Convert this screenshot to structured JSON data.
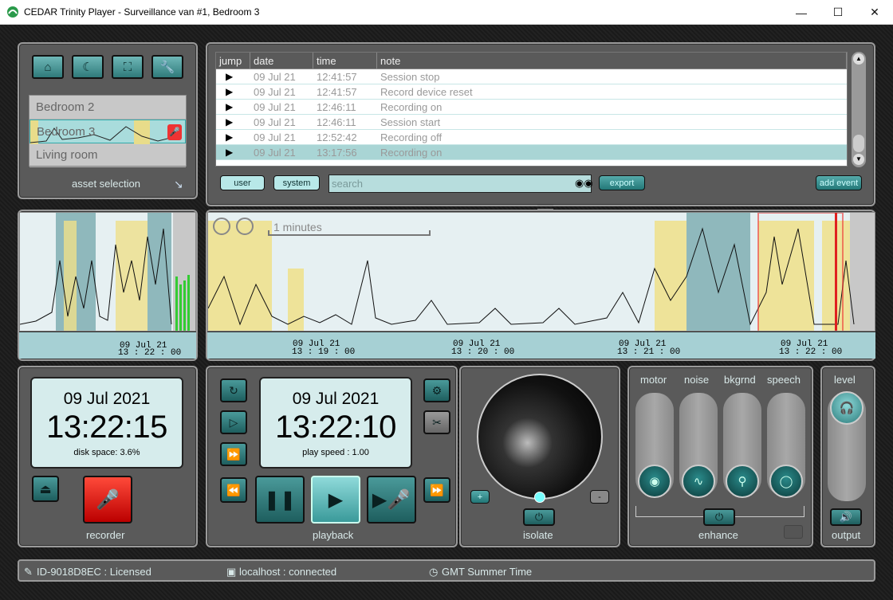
{
  "window": {
    "title": "CEDAR Trinity Player - Surveillance van #1, Bedroom 3"
  },
  "toolbar": {
    "icons": [
      "home-icon",
      "night-mode-icon",
      "fullscreen-icon",
      "settings-wrench-icon"
    ]
  },
  "assets": {
    "items": [
      "Bedroom 2",
      "Bedroom 3",
      "Living room"
    ],
    "selected": "Bedroom 3",
    "label": "asset selection"
  },
  "log": {
    "columns": [
      "jump",
      "date",
      "time",
      "note"
    ],
    "rows": [
      {
        "date": "09 Jul 21",
        "time": "12:41:57",
        "note": "Session stop"
      },
      {
        "date": "09 Jul 21",
        "time": "12:41:57",
        "note": "Record device reset"
      },
      {
        "date": "09 Jul 21",
        "time": "12:46:11",
        "note": "Recording on"
      },
      {
        "date": "09 Jul 21",
        "time": "12:46:11",
        "note": "Session start"
      },
      {
        "date": "09 Jul 21",
        "time": "12:52:42",
        "note": "Recording off"
      },
      {
        "date": "09 Jul 21",
        "time": "13:17:56",
        "note": "Recording on"
      }
    ],
    "filters": {
      "user": "user",
      "system": "system"
    },
    "search_placeholder": "search",
    "export": "export",
    "add_event": "add event"
  },
  "timeline": {
    "zoom_label": "1 minutes",
    "left_tick": {
      "date": "09 Jul 21",
      "time": "13 : 22 : 00"
    },
    "ticks": [
      {
        "date": "09 Jul 21",
        "time": "13 : 19 : 00"
      },
      {
        "date": "09 Jul 21",
        "time": "13 : 20 : 00"
      },
      {
        "date": "09 Jul 21",
        "time": "13 : 21 : 00"
      },
      {
        "date": "09 Jul 21",
        "time": "13 : 22 : 00"
      }
    ]
  },
  "recorder": {
    "date": "09 Jul 2021",
    "time": "13:22:15",
    "disk": "disk space: 3.6%",
    "label": "recorder"
  },
  "playback": {
    "date": "09 Jul 2021",
    "time": "13:22:10",
    "speed": "play speed : 1.00",
    "label": "playback"
  },
  "isolate": {
    "label": "isolate",
    "plus": "+",
    "minus": "-"
  },
  "enhance": {
    "label": "enhance",
    "sliders": [
      "motor",
      "noise",
      "bkgrnd",
      "speech"
    ]
  },
  "output": {
    "level": "level",
    "label": "output"
  },
  "status": {
    "license": "ID-9018D8EC : Licensed",
    "network": "localhost : connected",
    "tz": "GMT Summer Time"
  },
  "colors": {
    "accent": "#2f7a7a",
    "record": "#e02020",
    "highlight": "#a9d5d5",
    "speech_band": "#f0e08c"
  }
}
